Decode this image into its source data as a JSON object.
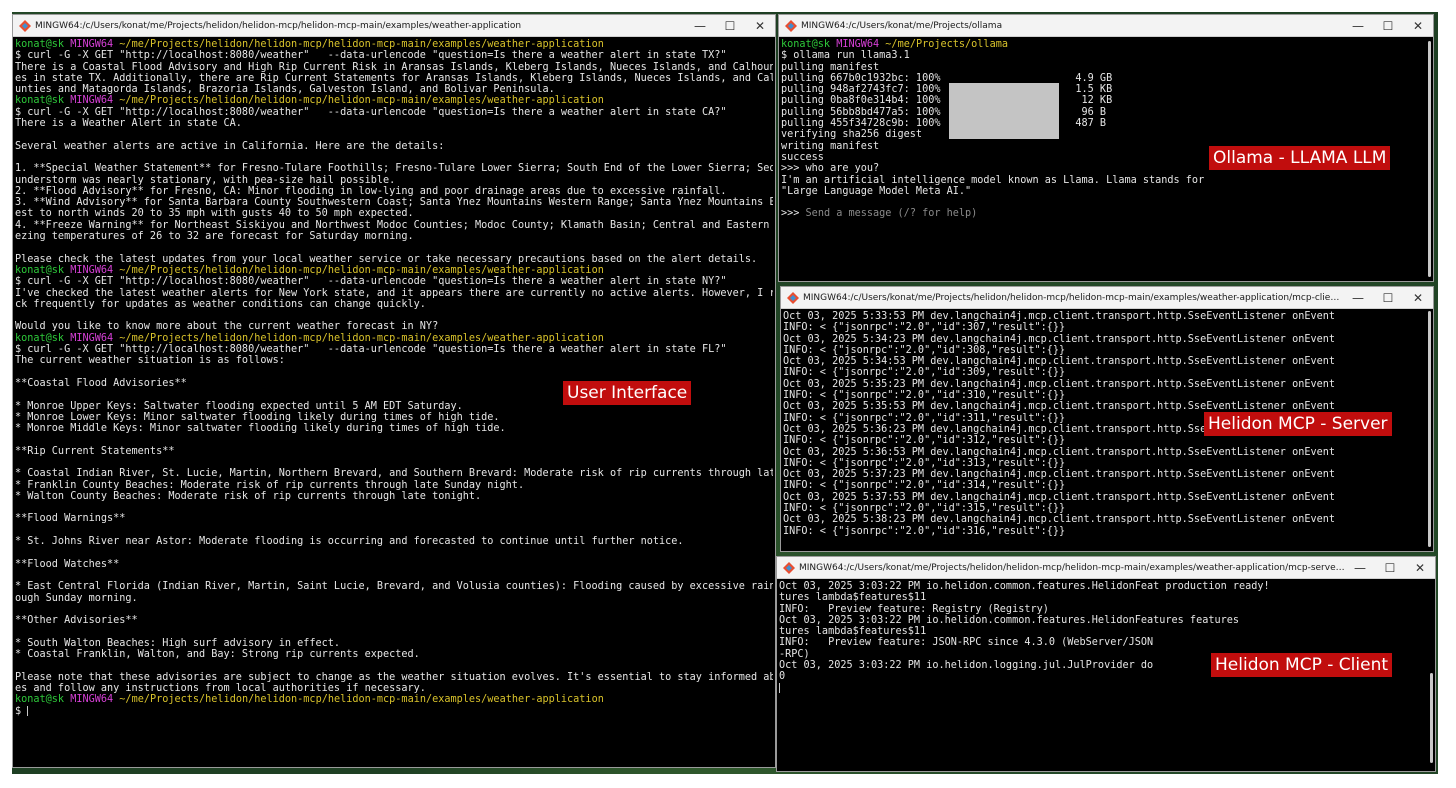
{
  "windows": {
    "ui": {
      "title": "MINGW64:/c/Users/konat/me/Projects/helidon/helidon-mcp/helidon-mcp-main/examples/weather-application",
      "label": "User Interface",
      "lines": [
        {
          "p": [
            "konat@sk",
            "MINGW64",
            "~/me/Projects/helidon/helidon-mcp/helidon-mcp-main/examples/weather-application"
          ]
        },
        {
          "t": "$ curl -G -X GET \"http://localhost:8080/weather\"   --data-urlencode \"question=Is there a weather alert in state TX?\""
        },
        {
          "t": "There is a Coastal Flood Advisory and High Rip Current Risk in Aransas Islands, Kleberg Islands, Nueces Islands, and Calhoun"
        },
        {
          "t": "es in state TX. Additionally, there are Rip Current Statements for Aransas Islands, Kleberg Islands, Nueces Islands, and Cal"
        },
        {
          "t": "unties and Matagorda Islands, Brazoria Islands, Galveston Island, and Bolivar Peninsula."
        },
        {
          "p": [
            "konat@sk",
            "MINGW64",
            "~/me/Projects/helidon/helidon-mcp/helidon-mcp-main/examples/weather-application"
          ]
        },
        {
          "t": "$ curl -G -X GET \"http://localhost:8080/weather\"   --data-urlencode \"question=Is there a weather alert in state CA?\""
        },
        {
          "t": "There is a Weather Alert in state CA."
        },
        {
          "t": ""
        },
        {
          "t": "Several weather alerts are active in California. Here are the details:"
        },
        {
          "t": ""
        },
        {
          "t": "1. **Special Weather Statement** for Fresno-Tulare Foothills; Fresno-Tulare Lower Sierra; South End of the Lower Sierra; Seq"
        },
        {
          "t": "understorm was nearly stationary, with pea-size hail possible."
        },
        {
          "t": "2. **Flood Advisory** for Fresno, CA: Minor flooding in low-lying and poor drainage areas due to excessive rainfall."
        },
        {
          "t": "3. **Wind Advisory** for Santa Barbara County Southwestern Coast; Santa Ynez Mountains Western Range; Santa Ynez Mountains E"
        },
        {
          "t": "est to north winds 20 to 35 mph with gusts 40 to 50 mph expected."
        },
        {
          "t": "4. **Freeze Warning** for Northeast Siskiyou and Northwest Modoc Counties; Modoc County; Klamath Basin; Central and Eastern"
        },
        {
          "t": "ezing temperatures of 26 to 32 are forecast for Saturday morning."
        },
        {
          "t": ""
        },
        {
          "t": "Please check the latest updates from your local weather service or take necessary precautions based on the alert details."
        },
        {
          "p": [
            "konat@sk",
            "MINGW64",
            "~/me/Projects/helidon/helidon-mcp/helidon-mcp-main/examples/weather-application"
          ]
        },
        {
          "t": "$ curl -G -X GET \"http://localhost:8080/weather\"   --data-urlencode \"question=Is there a weather alert in state NY?\""
        },
        {
          "t": "I've checked the latest weather alerts for New York state, and it appears there are currently no active alerts. However, I r"
        },
        {
          "t": "ck frequently for updates as weather conditions can change quickly."
        },
        {
          "t": ""
        },
        {
          "t": "Would you like to know more about the current weather forecast in NY?"
        },
        {
          "p": [
            "konat@sk",
            "MINGW64",
            "~/me/Projects/helidon/helidon-mcp/helidon-mcp-main/examples/weather-application"
          ]
        },
        {
          "t": "$ curl -G -X GET \"http://localhost:8080/weather\"   --data-urlencode \"question=Is there a weather alert in state FL?\""
        },
        {
          "t": "The current weather situation is as follows:"
        },
        {
          "t": ""
        },
        {
          "t": "**Coastal Flood Advisories**"
        },
        {
          "t": ""
        },
        {
          "t": "* Monroe Upper Keys: Saltwater flooding expected until 5 AM EDT Saturday."
        },
        {
          "t": "* Monroe Lower Keys: Minor saltwater flooding likely during times of high tide."
        },
        {
          "t": "* Monroe Middle Keys: Minor saltwater flooding likely during times of high tide."
        },
        {
          "t": ""
        },
        {
          "t": "**Rip Current Statements**"
        },
        {
          "t": ""
        },
        {
          "t": "* Coastal Indian River, St. Lucie, Martin, Northern Brevard, and Southern Brevard: Moderate risk of rip currents through lat"
        },
        {
          "t": "* Franklin County Beaches: Moderate risk of rip currents through late Sunday night."
        },
        {
          "t": "* Walton County Beaches: Moderate risk of rip currents through late tonight."
        },
        {
          "t": ""
        },
        {
          "t": "**Flood Warnings**"
        },
        {
          "t": ""
        },
        {
          "t": "* St. Johns River near Astor: Moderate flooding is occurring and forecasted to continue until further notice."
        },
        {
          "t": ""
        },
        {
          "t": "**Flood Watches**"
        },
        {
          "t": ""
        },
        {
          "t": "* East Central Florida (Indian River, Martin, Saint Lucie, Brevard, and Volusia counties): Flooding caused by excessive rain"
        },
        {
          "t": "ough Sunday morning."
        },
        {
          "t": ""
        },
        {
          "t": "**Other Advisories**"
        },
        {
          "t": ""
        },
        {
          "t": "* South Walton Beaches: High surf advisory in effect."
        },
        {
          "t": "* Coastal Franklin, Walton, and Bay: Strong rip currents expected."
        },
        {
          "t": ""
        },
        {
          "t": "Please note that these advisories are subject to change as the weather situation evolves. It's essential to stay informed ab"
        },
        {
          "t": "es and follow any instructions from local authorities if necessary."
        },
        {
          "p": [
            "konat@sk",
            "MINGW64",
            "~/me/Projects/helidon/helidon-mcp/helidon-mcp-main/examples/weather-application"
          ]
        },
        {
          "t": "$ ",
          "cursor": true
        }
      ]
    },
    "ollama": {
      "title": "MINGW64:/c/Users/konat/me/Projects/ollama",
      "label": "Ollama - LLAMA LLM",
      "lines": [
        {
          "p": [
            "konat@sk",
            "MINGW64",
            "~/me/Projects/ollama"
          ]
        },
        {
          "t": "$ ollama run llama3.1"
        },
        {
          "t": "pulling manifest"
        },
        {
          "t": "pulling 667b0c1932bc: 100%                      4.9 GB"
        },
        {
          "t": "pulling 948af2743fc7: 100%                      1.5 KB"
        },
        {
          "t": "pulling 0ba8f0e314b4: 100%                       12 KB"
        },
        {
          "t": "pulling 56bb8bd477a5: 100%                       96 B"
        },
        {
          "t": "pulling 455f34728c9b: 100%                      487 B"
        },
        {
          "t": "verifying sha256 digest"
        },
        {
          "t": "writing manifest"
        },
        {
          "t": "success"
        },
        {
          "t": ">>> who are you?"
        },
        {
          "t": "I'm an artificial intelligence model known as Llama. Llama stands for"
        },
        {
          "t": "\"Large Language Model Meta AI.\""
        },
        {
          "t": ""
        },
        {
          "t": ">>> ",
          "hint": "Send a message (/? for help)"
        }
      ]
    },
    "server": {
      "title": "MINGW64:/c/Users/konat/me/Projects/helidon/helidon-mcp/helidon-mcp-main/examples/weather-application/mcp-client/target",
      "label": "Helidon MCP - Server",
      "lines": [
        {
          "t": "Oct 03, 2025 5:33:53 PM dev.langchain4j.mcp.client.transport.http.SseEventListener onEvent"
        },
        {
          "t": "INFO: < {\"jsonrpc\":\"2.0\",\"id\":307,\"result\":{}}"
        },
        {
          "t": "Oct 03, 2025 5:34:23 PM dev.langchain4j.mcp.client.transport.http.SseEventListener onEvent"
        },
        {
          "t": "INFO: < {\"jsonrpc\":\"2.0\",\"id\":308,\"result\":{}}"
        },
        {
          "t": "Oct 03, 2025 5:34:53 PM dev.langchain4j.mcp.client.transport.http.SseEventListener onEvent"
        },
        {
          "t": "INFO: < {\"jsonrpc\":\"2.0\",\"id\":309,\"result\":{}}"
        },
        {
          "t": "Oct 03, 2025 5:35:23 PM dev.langchain4j.mcp.client.transport.http.SseEventListener onEvent"
        },
        {
          "t": "INFO: < {\"jsonrpc\":\"2.0\",\"id\":310,\"result\":{}}"
        },
        {
          "t": "Oct 03, 2025 5:35:53 PM dev.langchain4j.mcp.client.transport.http.SseEventListener onEvent"
        },
        {
          "t": "INFO: < {\"jsonrpc\":\"2.0\",\"id\":311,\"result\":{}}"
        },
        {
          "t": "Oct 03, 2025 5:36:23 PM dev.langchain4j.mcp.client.transport.http.SseE"
        },
        {
          "t": "INFO: < {\"jsonrpc\":\"2.0\",\"id\":312,\"result\":{}}"
        },
        {
          "t": "Oct 03, 2025 5:36:53 PM dev.langchain4j.mcp.client.transport.http.SseEventListener onEvent"
        },
        {
          "t": "INFO: < {\"jsonrpc\":\"2.0\",\"id\":313,\"result\":{}}"
        },
        {
          "t": "Oct 03, 2025 5:37:23 PM dev.langchain4j.mcp.client.transport.http.SseEventListener onEvent"
        },
        {
          "t": "INFO: < {\"jsonrpc\":\"2.0\",\"id\":314,\"result\":{}}"
        },
        {
          "t": "Oct 03, 2025 5:37:53 PM dev.langchain4j.mcp.client.transport.http.SseEventListener onEvent"
        },
        {
          "t": "INFO: < {\"jsonrpc\":\"2.0\",\"id\":315,\"result\":{}}"
        },
        {
          "t": "Oct 03, 2025 5:38:23 PM dev.langchain4j.mcp.client.transport.http.SseEventListener onEvent"
        },
        {
          "t": "INFO: < {\"jsonrpc\":\"2.0\",\"id\":316,\"result\":{}}"
        }
      ]
    },
    "client": {
      "title": "MINGW64:/c/Users/konat/me/Projects/helidon/helidon-mcp/helidon-mcp-main/examples/weather-application/mcp-server/target",
      "label": "Helidon MCP - Client",
      "lines": [
        {
          "t": "Oct 03, 2025 3:03:22 PM io.helidon.common.features.HelidonFeat production ready!"
        },
        {
          "t": "tures lambda$features$11"
        },
        {
          "t": "INFO:   Preview feature: Registry (Registry)"
        },
        {
          "t": "Oct 03, 2025 3:03:22 PM io.helidon.common.features.HelidonFeatures features"
        },
        {
          "t": "tures lambda$features$11"
        },
        {
          "t": "INFO:   Preview feature: JSON-RPC since 4.3.0 (WebServer/JSON"
        },
        {
          "t": "-RPC)"
        },
        {
          "t": "Oct 03, 2025 3:03:22 PM io.helidon.logging.jul.JulProvider do"
        },
        {
          "t": "0"
        },
        {
          "t": "",
          "cursor": true
        }
      ]
    }
  },
  "controls": {
    "minimize": "—",
    "maximize": "☐",
    "close": "✕"
  },
  "colors": {
    "prompt_user": "#2ec93a",
    "prompt_host": "#d640d6",
    "prompt_path": "#d8c22b",
    "label_bg": "#c10d0d"
  }
}
